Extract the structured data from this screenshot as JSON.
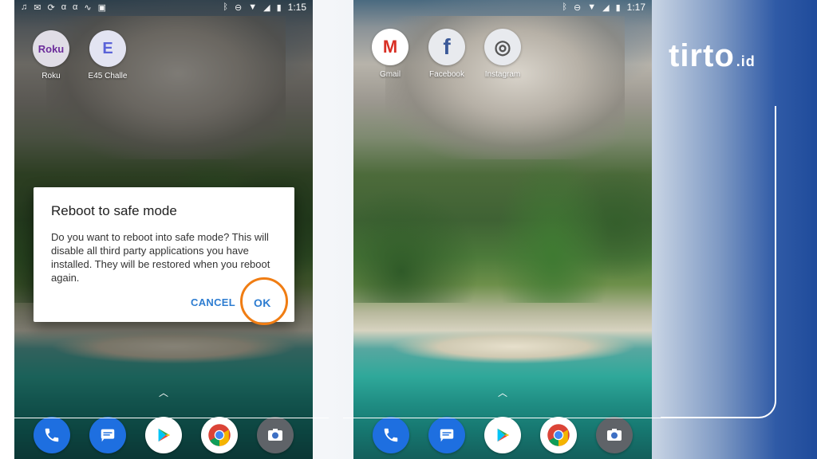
{
  "brand": {
    "name": "tirto",
    "suffix": ".id"
  },
  "left_phone": {
    "status": {
      "time": "1:15",
      "left_icons": [
        "music-note",
        "mail",
        "sync",
        "alpha",
        "alpha",
        "pulse",
        "picture"
      ],
      "right_icons": [
        "bluetooth",
        "do-not-disturb",
        "wifi",
        "signal",
        "battery"
      ]
    },
    "apps": [
      {
        "label": "Roku",
        "icon_text": "Roku",
        "color": "#6c2d9b"
      },
      {
        "label": "E45 Challe",
        "icon_text": "E",
        "color": "#5a63d8"
      }
    ],
    "dialog": {
      "title": "Reboot to safe mode",
      "body": "Do you want to reboot into safe mode? This will disable all third party applications you have installed. They will be restored when you reboot again.",
      "cancel_label": "CANCEL",
      "ok_label": "OK"
    },
    "dock": [
      "phone",
      "messages",
      "play-store",
      "chrome",
      "camera"
    ]
  },
  "right_phone": {
    "status": {
      "time": "1:17",
      "right_icons": [
        "bluetooth",
        "do-not-disturb",
        "wifi",
        "signal",
        "battery"
      ]
    },
    "apps": [
      {
        "label": "Gmail",
        "icon_text": "M",
        "color": "#ffffff"
      },
      {
        "label": "Facebook",
        "icon_text": "f",
        "color": "#3b5998"
      },
      {
        "label": "Instagram",
        "icon_text": "◎",
        "color": "#e1306c"
      }
    ],
    "dock": [
      "phone",
      "messages",
      "play-store",
      "chrome",
      "camera"
    ]
  },
  "colors": {
    "dialog_button": "#2e7dd1",
    "ok_highlight": "#f07d13",
    "brand_blue": "#1f4b9b"
  }
}
